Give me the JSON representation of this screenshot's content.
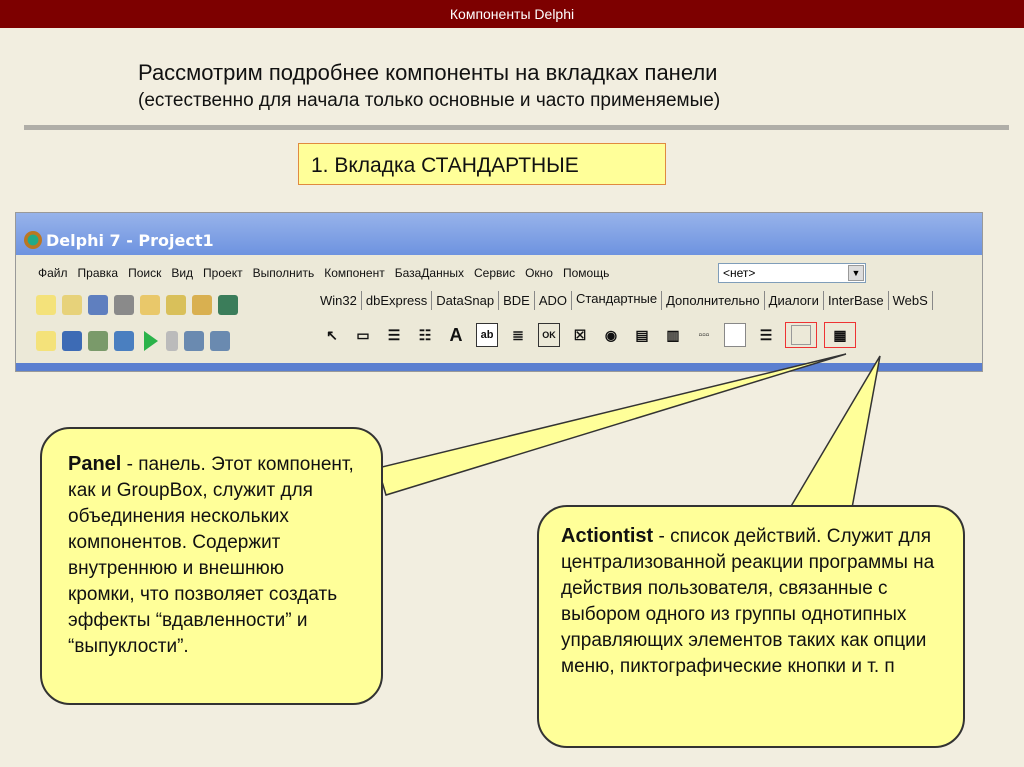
{
  "slide": {
    "header": "Компоненты Delphi",
    "title": "Рассмотрим подробнее компоненты на вкладках панели",
    "subtitle": "(естественно для начала только основные и часто применяемые)",
    "section": "1. Вкладка СТАНДАРТНЫЕ"
  },
  "window": {
    "title": "Delphi 7 - Project1",
    "menu": [
      "Файл",
      "Правка",
      "Поиск",
      "Вид",
      "Проект",
      "Выполнить",
      "Компонент",
      "БазаДанных",
      "Сервис",
      "Окно",
      "Помощь"
    ],
    "combo_value": "<нет>",
    "tabs": [
      "Win32",
      "dbExpress",
      "DataSnap",
      "BDE",
      "ADO",
      "Стандартные",
      "Дополнительно",
      "Диалоги",
      "InterBase",
      "WebS"
    ],
    "active_tab": "Стандартные",
    "palette": [
      "pointer-icon",
      "frames-icon",
      "mainmenu-icon",
      "popupmenu-icon",
      "label-icon",
      "edit-icon",
      "memo-icon",
      "button-icon",
      "checkbox-icon",
      "radiobutton-icon",
      "listbox-icon",
      "combobox-icon",
      "scrollbar-icon",
      "groupbox-icon",
      "radiogroup-icon",
      "panel-icon",
      "actionlist-icon"
    ]
  },
  "callouts": {
    "panel": {
      "name": "Panel",
      "text": " - панель. Этот компонент, как и GroupBox, служит для объединения нескольких компонентов. Содержит внутреннюю и внешнюю кромки, что позволяет создать эффекты “вдавленности” и “выпуклости”."
    },
    "actionlist": {
      "name": "Actiontist",
      "text": " - список действий. Служит для централизованной реакции программы на действия пользователя, связанные с выбором одного из группы однотипных управляющих элементов таких как опции меню, пиктографические кнопки и т. п"
    }
  }
}
